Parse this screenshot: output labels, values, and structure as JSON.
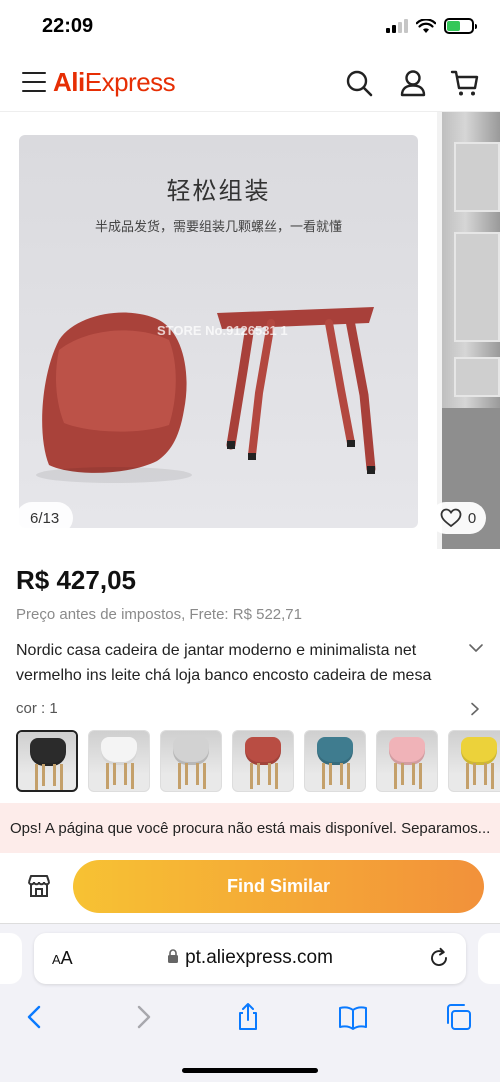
{
  "status_bar": {
    "time": "22:09"
  },
  "header": {
    "logo_part1": "Ali",
    "logo_part2": "Express"
  },
  "gallery": {
    "photo_title": "轻松组装",
    "photo_subtitle": "半成品发货，需要组装几颗螺丝，一看就懂",
    "watermark": "STORE No.9126531 1",
    "counter": "6/13",
    "wishlist_count": "0"
  },
  "product": {
    "price": "R$ 427,05",
    "subprice": "Preço antes de impostos, Frete: R$ 522,71",
    "title": "Nordic casa cadeira de jantar moderno e minimalista net vermelho ins leite chá loja banco encosto cadeira de mesa",
    "color_label": "cor : 1",
    "swatches": [
      {
        "name": "black",
        "color": "#2b2b2b"
      },
      {
        "name": "white",
        "color": "#f4f4f4"
      },
      {
        "name": "light-gray",
        "color": "#d2d2d2"
      },
      {
        "name": "red",
        "color": "#b94d43"
      },
      {
        "name": "blue",
        "color": "#3f7c8f"
      },
      {
        "name": "pink",
        "color": "#f0b3b8"
      },
      {
        "name": "yellow",
        "color": "#ecd23a"
      }
    ]
  },
  "notice": {
    "text": "Ops! A página que você procura não está mais disponível. Separamos"
  },
  "action": {
    "find_similar": "Find Similar"
  },
  "browser": {
    "aa_label_small": "A",
    "aa_label_large": "A",
    "url": "pt.aliexpress.com"
  },
  "colors": {
    "brand": "#e62e04",
    "button_gradient_start": "#f7c233",
    "button_gradient_end": "#f2913a",
    "notice_bg": "#fdecea",
    "ios_blue": "#0a7aff"
  }
}
